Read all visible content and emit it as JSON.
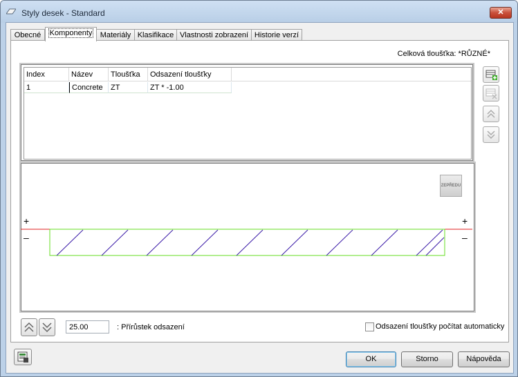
{
  "window": {
    "title": "Styly desek - Standard",
    "close_label": "✕"
  },
  "tabs": [
    {
      "label": "Obecné",
      "active": false
    },
    {
      "label": "Komponenty",
      "active": true
    },
    {
      "label": "Materiály",
      "active": false
    },
    {
      "label": "Klasifikace",
      "active": false
    },
    {
      "label": "Vlastnosti zobrazení",
      "active": false
    },
    {
      "label": "Historie verzí",
      "active": false
    }
  ],
  "total_thickness": "Celková tloušťka: *RŮZNÉ*",
  "grid": {
    "columns": [
      "Index",
      "Název",
      "Tloušťka",
      "Odsazení tloušťky"
    ],
    "rows": [
      {
        "index": "1",
        "name": "Concrete",
        "thickness": "ZT",
        "offset": "ZT * -1.00"
      }
    ]
  },
  "side_buttons": [
    "add-component-icon",
    "delete-component-icon",
    "move-up-icon",
    "move-down-icon"
  ],
  "preview": {
    "view_button": "ZEPŘEDU",
    "plus_label": "+",
    "minus_label": "–",
    "colors": {
      "top_line": "#e02020",
      "outline": "#66dd22",
      "hatch": "#3a1aa8"
    }
  },
  "increment": {
    "value": "25.00",
    "label": ": Přírůstek odsazení"
  },
  "auto_offset": {
    "label": "Odsazení tloušťky počítat automaticky",
    "checked": false
  },
  "buttons": {
    "ok": "OK",
    "cancel": "Storno",
    "help": "Nápověda"
  }
}
